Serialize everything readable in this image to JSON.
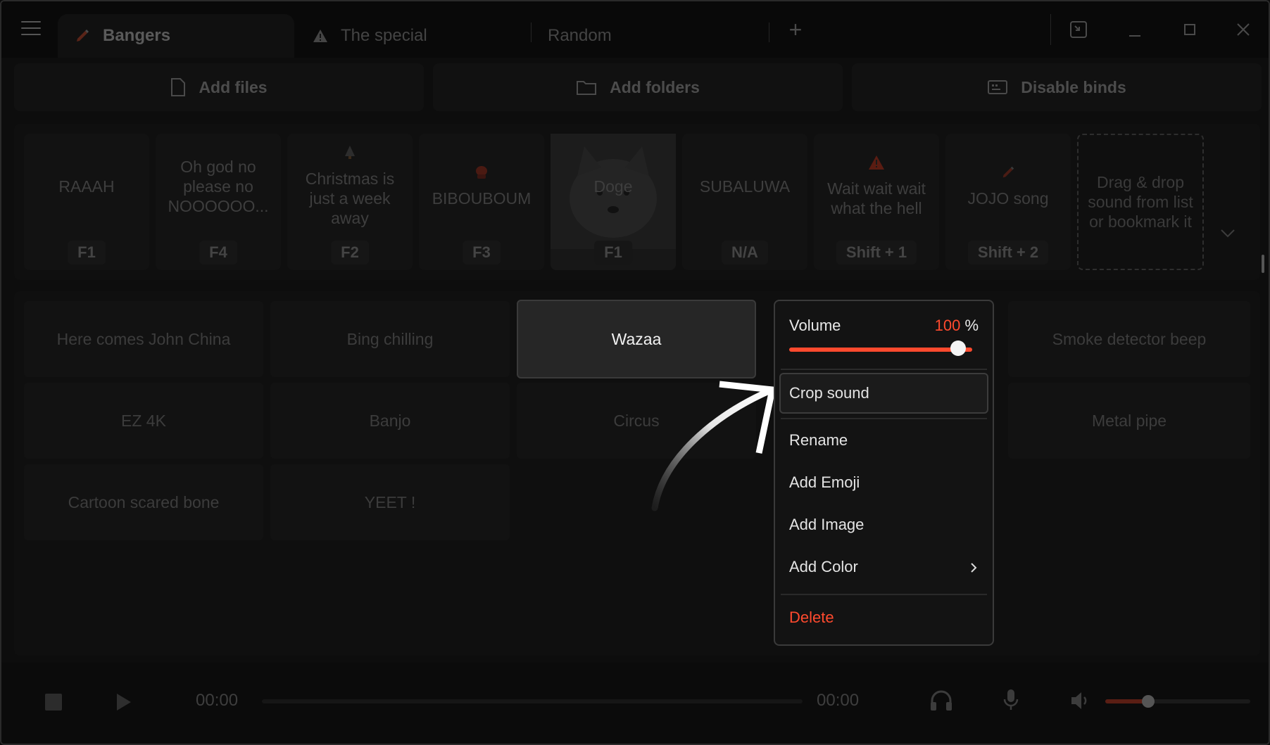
{
  "tabs": [
    {
      "label": "Bangers",
      "icon": "pencil-icon",
      "active": true
    },
    {
      "label": "The special",
      "icon": "warning-icon",
      "active": false
    },
    {
      "label": "Random",
      "icon": "",
      "active": false
    }
  ],
  "new_tab_glyph": "+",
  "actions": {
    "add_files": "Add files",
    "add_folders": "Add folders",
    "disable_binds": "Disable binds"
  },
  "bookmarks": [
    {
      "label": "RAAAH",
      "key": "F1"
    },
    {
      "label": "Oh god no please no NOOOOOO...",
      "key": "F4"
    },
    {
      "label": "Christmas is just a week away",
      "key": "F2",
      "emoji": "christmas-tree-icon"
    },
    {
      "label": "BIBOUBOUM",
      "key": "F3",
      "emoji": "boxing-glove-icon"
    },
    {
      "label": "Doge",
      "key": "F1",
      "image": "doge-image"
    },
    {
      "label": "SUBALUWA",
      "key": "N/A"
    },
    {
      "label": "Wait wait wait what the hell",
      "key": "Shift + 1",
      "emoji": "warning-icon"
    },
    {
      "label": "JOJO song",
      "key": "Shift + 2",
      "emoji": "pencil-icon"
    }
  ],
  "dropzone_text": "Drag & drop sound from list or bookmark it",
  "sounds": [
    "Here comes John China",
    "Bing chilling",
    "Wazaa",
    "Smoke detector beep",
    "EZ 4K",
    "Banjo",
    "Circus",
    "Metal pipe",
    "Cartoon scared bone",
    "YEET !"
  ],
  "context_menu": {
    "volume_label": "Volume",
    "volume_value": "100",
    "volume_unit": "%",
    "volume_level": 1.0,
    "items": [
      "Crop sound",
      "Rename",
      "Add Emoji",
      "Add Image",
      "Add Color",
      "Delete"
    ]
  },
  "player": {
    "time_current": "00:00",
    "time_total": "00:00",
    "output_volume_level": 0.25
  },
  "colors": {
    "accent": "#ff4a2e",
    "background": "#0d0d0d",
    "menu_bg": "#131313"
  }
}
